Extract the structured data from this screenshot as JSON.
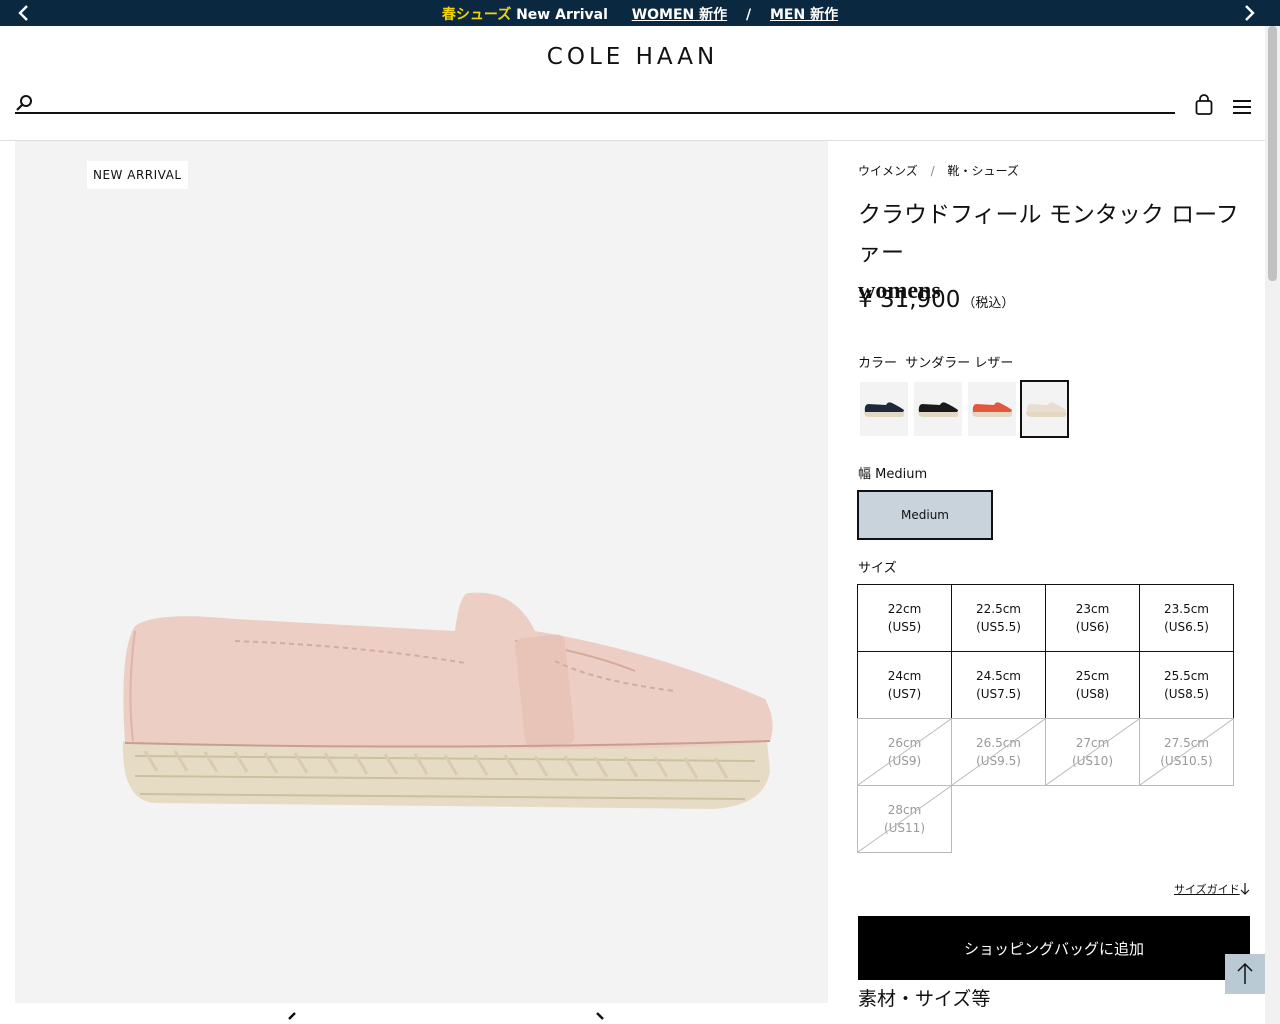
{
  "promo": {
    "highlight": "春シューズ",
    "text": " New Arrival",
    "women_link": "WOMEN 新作",
    "separator": "/",
    "men_link": "MEN 新作"
  },
  "header": {
    "logo": "COLE HAAN",
    "search_placeholder": ""
  },
  "gallery": {
    "badge": "NEW ARRIVAL"
  },
  "breadcrumb": {
    "items": [
      "ウイメンズ",
      "靴・シューズ"
    ],
    "separator": "/"
  },
  "product": {
    "title_line1": "クラウドフィール モンタック ローファー",
    "title_line2": "womens",
    "price": "¥ 31,900",
    "price_note": "（税込）",
    "color_label": "カラー",
    "color_value": "サンダラー レザー",
    "swatch_colors": [
      "#1d2a3c",
      "#1a1a1a",
      "#e2583a",
      "#e8ddd1"
    ],
    "selected_swatch_index": 3,
    "width_label": "幅",
    "width_value": "Medium",
    "width_option": "Medium",
    "size_label": "サイズ",
    "sizes": [
      {
        "cm": "22cm",
        "us": "(US5)",
        "available": true
      },
      {
        "cm": "22.5cm",
        "us": "(US5.5)",
        "available": true
      },
      {
        "cm": "23cm",
        "us": "(US6)",
        "available": true
      },
      {
        "cm": "23.5cm",
        "us": "(US6.5)",
        "available": true
      },
      {
        "cm": "24cm",
        "us": "(US7)",
        "available": true
      },
      {
        "cm": "24.5cm",
        "us": "(US7.5)",
        "available": true
      },
      {
        "cm": "25cm",
        "us": "(US8)",
        "available": true
      },
      {
        "cm": "25.5cm",
        "us": "(US8.5)",
        "available": true
      },
      {
        "cm": "26cm",
        "us": "(US9)",
        "available": false
      },
      {
        "cm": "26.5cm",
        "us": "(US9.5)",
        "available": false
      },
      {
        "cm": "27cm",
        "us": "(US10)",
        "available": false
      },
      {
        "cm": "27.5cm",
        "us": "(US10.5)",
        "available": false
      },
      {
        "cm": "28cm",
        "us": "(US11)",
        "available": false
      }
    ],
    "size_guide": "サイズガイド",
    "add_to_bag": "ショッピングバッグに追加",
    "material_heading": "素材・サイズ等"
  }
}
